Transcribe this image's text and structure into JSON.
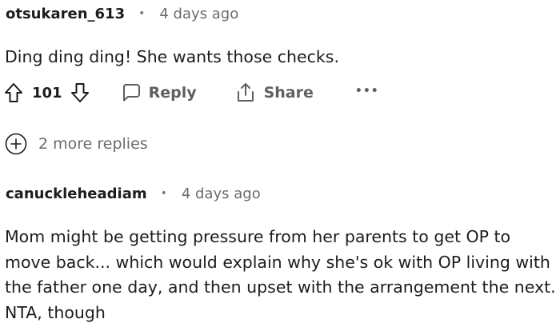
{
  "comments": [
    {
      "username": "otsukaren_613",
      "separator": "•",
      "time": "4 days ago",
      "text": "Ding ding ding! She wants those checks."
    },
    {
      "username": "canuckleheadiam",
      "separator": "•",
      "time": "4 days ago",
      "text": "Mom might be getting pressure from her parents to get OP to move back... which would explain why she's ok with OP living with the father one day, and then upset with the arrangement the next. NTA, though"
    }
  ],
  "actions": {
    "score": "101",
    "reply_label": "Reply",
    "share_label": "Share",
    "more_label": "•••",
    "icons": [
      "upvote-icon",
      "downvote-icon",
      "reply-icon",
      "share-icon",
      "more-options-icon"
    ]
  },
  "more_replies": {
    "icon": "plus-circle-icon",
    "label": "2 more replies"
  },
  "colors": {
    "text": "#1c1c1c",
    "muted": "#6b6b6b",
    "action": "#5f5f5f"
  }
}
